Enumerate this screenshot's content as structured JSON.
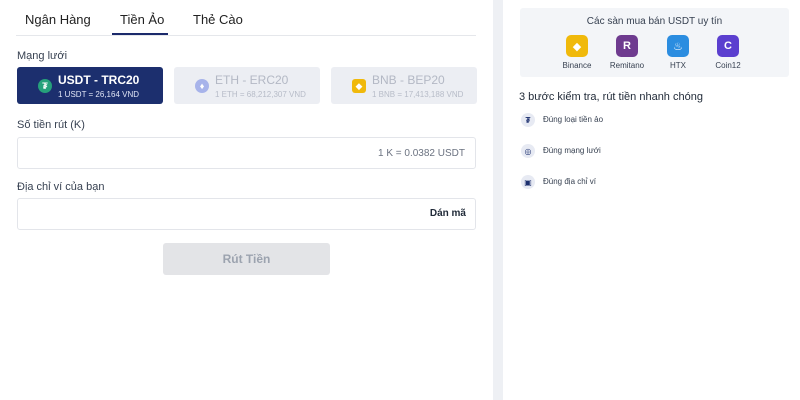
{
  "tabs": [
    {
      "label": "Ngân Hàng"
    },
    {
      "label": "Tiền Ảo"
    },
    {
      "label": "Thẻ Cào"
    }
  ],
  "network": {
    "label": "Mạng lưới",
    "options": [
      {
        "name": "USDT - TRC20",
        "rate": "1 USDT = 26,164 VND",
        "icon": "tether-icon"
      },
      {
        "name": "ETH - ERC20",
        "rate": "1 ETH = 68,212,307 VND",
        "icon": "ethereum-icon"
      },
      {
        "name": "BNB - BEP20",
        "rate": "1 BNB = 17,413,188 VND",
        "icon": "bnb-icon"
      }
    ]
  },
  "amount": {
    "label": "Số tiền rút (K)",
    "value": "",
    "hint": "1 K = 0.0382 USDT"
  },
  "wallet": {
    "label": "Địa chỉ ví của bạn",
    "value": "",
    "paste_label": "Dán mã"
  },
  "withdraw_label": "Rút Tiền",
  "exchanges": {
    "title": "Các sàn mua bán USDT uy tín",
    "items": [
      {
        "name": "Binance",
        "glyph": "◆"
      },
      {
        "name": "Remitano",
        "glyph": "R"
      },
      {
        "name": "HTX",
        "glyph": "♨"
      },
      {
        "name": "Coin12",
        "glyph": "C"
      }
    ]
  },
  "steps": {
    "title": "3 bước kiểm tra, rút tiền nhanh chóng",
    "items": [
      {
        "text": "Đúng loại tiền ảo",
        "glyph": "₮"
      },
      {
        "text": "Đúng mạng lưới",
        "glyph": "◎"
      },
      {
        "text": "Đúng địa chỉ ví",
        "glyph": "▣"
      }
    ]
  },
  "colors": {
    "primary": "#1c2f6e",
    "tether": "#26a17b",
    "binance": "#f0b90b"
  }
}
